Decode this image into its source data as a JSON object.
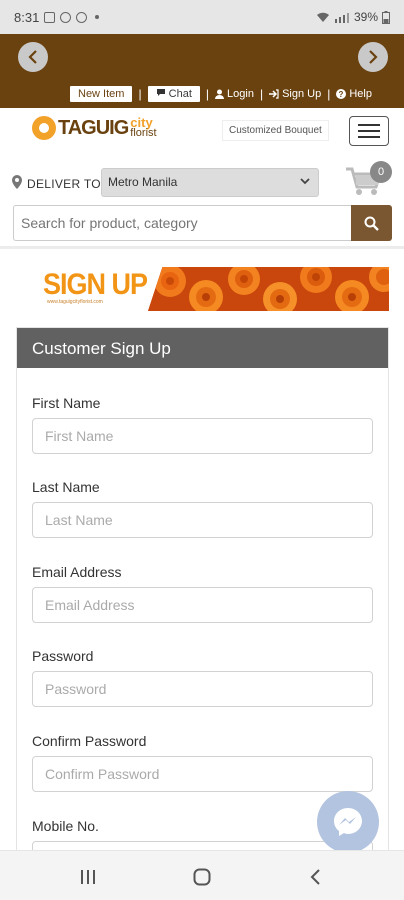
{
  "status_bar": {
    "time": "8:31",
    "battery": "39%"
  },
  "top_links": {
    "new_item": "New Item",
    "chat": "Chat",
    "login": "Login",
    "sign_up": "Sign Up",
    "help": "Help"
  },
  "header": {
    "logo_main": "TAGUIG",
    "logo_city": "city",
    "logo_florist": "florist",
    "customized_bouquet": "Customized Bouquet"
  },
  "delivery": {
    "label": "DELIVER TO",
    "selected": "Metro Manila",
    "cart_count": "0"
  },
  "search": {
    "placeholder": "Search for product, category"
  },
  "banner": {
    "title": "SIGN UP",
    "url": "www.taguigcityflorist.com"
  },
  "form": {
    "title": "Customer Sign Up",
    "fields": [
      {
        "label": "First Name",
        "placeholder": "First Name"
      },
      {
        "label": "Last Name",
        "placeholder": "Last Name"
      },
      {
        "label": "Email Address",
        "placeholder": "Email Address"
      },
      {
        "label": "Password",
        "placeholder": "Password"
      },
      {
        "label": "Confirm Password",
        "placeholder": "Confirm Password"
      },
      {
        "label": "Mobile No.",
        "placeholder": ""
      }
    ]
  },
  "colors": {
    "brand_brown": "#6a4210",
    "accent_orange": "#f29516",
    "panel_header": "#616161"
  }
}
